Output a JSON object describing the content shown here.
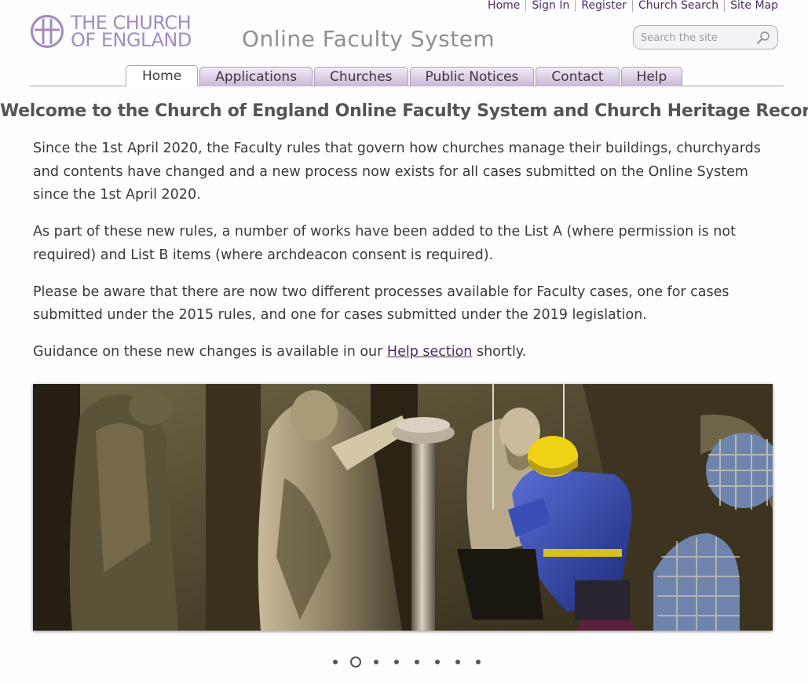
{
  "utility_nav": {
    "items": [
      {
        "label": "Home"
      },
      {
        "label": "Sign In"
      },
      {
        "label": "Register"
      },
      {
        "label": "Church Search"
      },
      {
        "label": "Site Map"
      }
    ]
  },
  "header": {
    "logo_line1": "THE CHURCH",
    "logo_line2": "OF ENGLAND",
    "site_title": "Online Faculty System",
    "logo_icon": "cross-circle-icon"
  },
  "search": {
    "placeholder": "Search the site",
    "value": "",
    "icon": "search-icon"
  },
  "main_nav": {
    "tabs": [
      {
        "label": "Home",
        "active": true
      },
      {
        "label": "Applications",
        "active": false
      },
      {
        "label": "Churches",
        "active": false
      },
      {
        "label": "Public Notices",
        "active": false
      },
      {
        "label": "Contact",
        "active": false
      },
      {
        "label": "Help",
        "active": false
      }
    ]
  },
  "main": {
    "heading": "Welcome to the Church of England Online Faculty System and Church Heritage Record",
    "p1": "Since the 1st April 2020, the Faculty rules that govern how churches manage their buildings, churchyards and contents have changed and a new process now exists for all cases submitted on the Online System since the 1st April 2020.",
    "p2": "As part of these new rules, a number of works have been added to the List A (where permission is not required) and List B items (where archdeacon consent is required).",
    "p3": "Please be aware that there are now two different processes available for Faculty cases, one for cases submitted under the 2015 rules, and one for cases submitted under the 2019 legislation.",
    "p4_before": "Guidance on these new changes is available in our ",
    "p4_link": "Help section",
    "p4_after": " shortly."
  },
  "carousel": {
    "slide_count": 8,
    "active_index": 1
  },
  "colors": {
    "brand_purple": "#a58cbc",
    "link_purple": "#4a2d5e",
    "tab_fill": "#c9b6da"
  }
}
